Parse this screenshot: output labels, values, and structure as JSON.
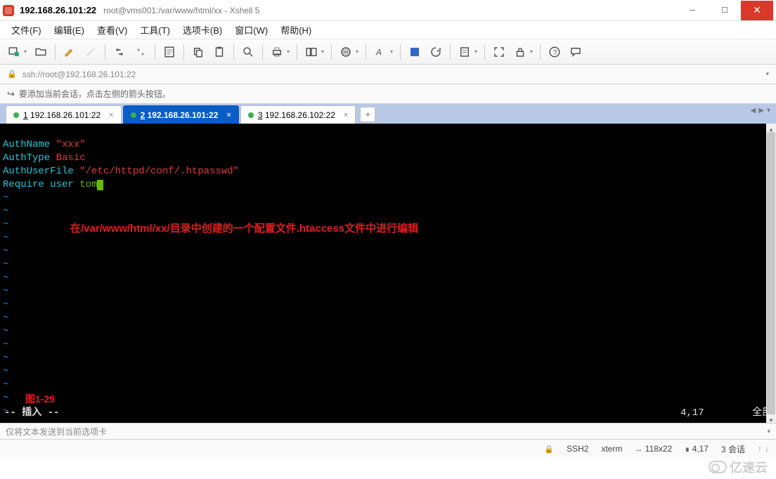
{
  "titlebar": {
    "ip": "192.168.26.101:22",
    "subtitle": "root@vms001:/var/www/html/xx - Xshell 5"
  },
  "menu": {
    "file": "文件(F)",
    "edit": "编辑(E)",
    "view": "查看(V)",
    "tools": "工具(T)",
    "tabs": "选项卡(B)",
    "window": "窗口(W)",
    "help": "帮助(H)"
  },
  "address": {
    "url": "ssh://root@192.168.26.101:22"
  },
  "hint": {
    "text": "要添加当前会话，点击左侧的箭头按钮。"
  },
  "tabs": [
    {
      "num": "1",
      "label": "192.168.26.101:22",
      "active": false
    },
    {
      "num": "2",
      "label": "192.168.26.101:22",
      "active": true
    },
    {
      "num": "3",
      "label": "192.168.26.102:22",
      "active": false
    }
  ],
  "terminal": {
    "l1_key": "AuthName ",
    "l1_val": "\"xxx\"",
    "l2_key": "AuthType ",
    "l2_val": "Basic",
    "l3_key": "AuthUserFile ",
    "l3_val": "\"/etc/httpd/conf/.htpasswd\"",
    "l4_key": "Require user ",
    "l4_val": "tom",
    "annotation": "在/var/www/html/xx/目录中创建的一个配置文件.htaccess文件中进行编辑",
    "fig": "图1-25",
    "mode": "-- 插入 --",
    "pos": "4,17",
    "pct": "全部"
  },
  "inputbar": {
    "text": "仅将文本发送到当前选项卡"
  },
  "status": {
    "proto": "SSH2",
    "term": "xterm",
    "size": "118x22",
    "cursor": "4,17",
    "sessions": "3 会话"
  },
  "watermark": "亿速云"
}
